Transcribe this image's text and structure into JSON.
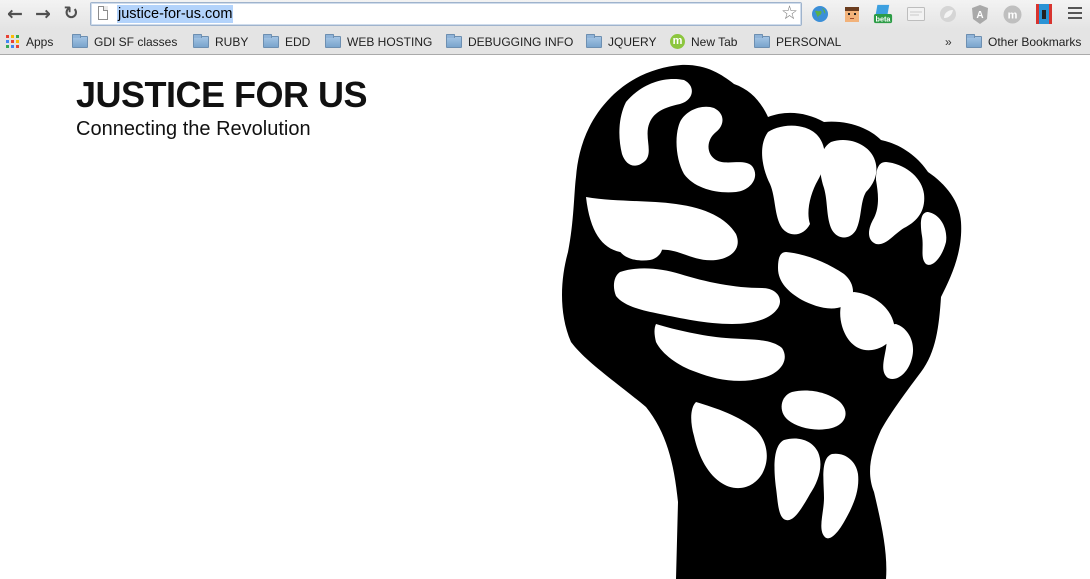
{
  "browser": {
    "url": "justice-for-us.com",
    "nav": {
      "back_icon": "back-arrow-icon",
      "forward_icon": "forward-arrow-icon",
      "reload_icon": "reload-icon"
    },
    "extensions": [
      {
        "name": "globe-extension-icon",
        "color": "#2f8fd6"
      },
      {
        "name": "pixel-face-extension-icon",
        "color": "#f4a460"
      },
      {
        "name": "beta-extension-icon",
        "label": "beta",
        "color": "#2aa34a"
      },
      {
        "name": "card-extension-icon",
        "color": "#d6d6d6"
      },
      {
        "name": "leaf-extension-icon",
        "color": "#cfcfcf"
      },
      {
        "name": "angular-extension-icon",
        "label": "A",
        "color": "#9a9a9a"
      },
      {
        "name": "m-extension-icon",
        "label": "m",
        "color": "#b5b5b5"
      },
      {
        "name": "pin-extension-icon",
        "color": "#d83a3a"
      }
    ]
  },
  "bookmarks": {
    "apps_label": "Apps",
    "items": [
      {
        "label": "GDI SF classes",
        "type": "folder"
      },
      {
        "label": "RUBY",
        "type": "folder"
      },
      {
        "label": "EDD",
        "type": "folder"
      },
      {
        "label": "WEB HOSTING",
        "type": "folder"
      },
      {
        "label": "DEBUGGING INFO",
        "type": "folder"
      },
      {
        "label": "JQUERY",
        "type": "folder"
      },
      {
        "label": "New Tab",
        "type": "page",
        "icon_letter": "m"
      },
      {
        "label": "PERSONAL",
        "type": "folder"
      }
    ],
    "overflow_label": "»",
    "other_label": "Other Bookmarks"
  },
  "page": {
    "title": "JUSTICE FOR US",
    "subtitle": "Connecting the Revolution",
    "image_icon": "raised-fist-icon"
  }
}
